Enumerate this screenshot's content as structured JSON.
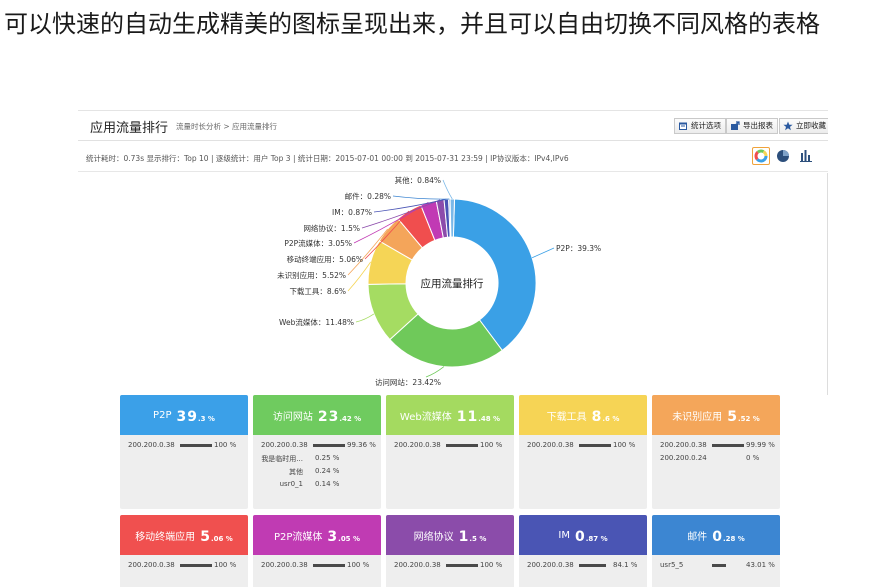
{
  "caption": "可以快速的自动生成精美的图标呈现出来，并且可以自由切换不同风格的表格",
  "header": {
    "title": "应用流量排行",
    "breadcrumb": "流量时长分析 > 应用流量排行",
    "buttons": [
      {
        "label": "统计选项",
        "icon": "calendar-icon"
      },
      {
        "label": "导出报表",
        "icon": "export-icon"
      },
      {
        "label": "立即收藏",
        "icon": "star-icon"
      }
    ]
  },
  "infobar": {
    "text": "统计耗时：0.73s   显示排行：Top 10   |   逐级统计：用户 Top 3   |   统计日期：2015-07-01 00:00 到 2015-07-31 23:59   |   IP协议版本：IPv4,IPv6",
    "view_buttons": [
      "donut-chart-icon",
      "pie-chart-icon",
      "bar-chart-icon"
    ]
  },
  "colors": {
    "p2p": "#3aa0e6",
    "visit": "#6fc95a",
    "web": "#a5dc62",
    "download": "#f5d556",
    "unknown": "#f4a55a",
    "mobile": "#f04e4e",
    "p2pmedia": "#c13ab4",
    "netproto": "#8c4cab",
    "im": "#4a54b5",
    "mail": "#3c85d1",
    "other": "#7ab8e8"
  },
  "chart_data": {
    "type": "pie",
    "title": "应用流量排行",
    "categories": [
      "P2P",
      "访问网站",
      "Web流媒体",
      "下载工具",
      "未识别应用",
      "移动终端应用",
      "P2P流媒体",
      "网络协议",
      "IM",
      "邮件",
      "其他"
    ],
    "values": [
      39.3,
      23.42,
      11.48,
      8.6,
      5.52,
      5.06,
      3.05,
      1.5,
      0.87,
      0.28,
      0.84
    ],
    "labels": [
      "P2P：39.3%",
      "访问网站：23.42%",
      "Web流媒体：11.48%",
      "下载工具：8.6%",
      "未识别应用：5.52%",
      "移动终端应用：5.06%",
      "P2P流媒体：3.05%",
      "网络协议：1.5%",
      "IM：0.87%",
      "邮件：0.28%",
      "其他：0.84%"
    ]
  },
  "cards": [
    {
      "label": "P2P",
      "big": "39",
      "small": ".3 %",
      "color": "#3ba0e8",
      "rows": [
        {
          "name": "200.200.0.38",
          "fill": 1.0,
          "pct": "100 %"
        }
      ]
    },
    {
      "label": "访问网站",
      "big": "23",
      "small": ".42 %",
      "color": "#6fcb5f",
      "rows": [
        {
          "name": "200.200.0.38",
          "fill": 0.9936,
          "pct": "99.36 %"
        },
        {
          "name": "我是临时用...",
          "pct": "0.25 %",
          "plain": true
        },
        {
          "name": "其他",
          "pct": "0.24 %",
          "plain": true
        },
        {
          "name": "usr0_1",
          "pct": "0.14 %",
          "plain": true
        }
      ]
    },
    {
      "label": "Web流媒体",
      "big": "11",
      "small": ".48 %",
      "color": "#a4da60",
      "rows": [
        {
          "name": "200.200.0.38",
          "fill": 1.0,
          "pct": "100 %"
        }
      ]
    },
    {
      "label": "下载工具",
      "big": "8",
      "small": ".6 %",
      "color": "#f6d455",
      "rows": [
        {
          "name": "200.200.0.38",
          "fill": 1.0,
          "pct": "100 %"
        }
      ]
    },
    {
      "label": "未识别应用",
      "big": "5",
      "small": ".52 %",
      "color": "#f4a65a",
      "rows": [
        {
          "name": "200.200.0.38",
          "fill": 0.9999,
          "pct": "99.99 %"
        },
        {
          "name": "200.200.0.24",
          "fill": 0.0,
          "pct": "0 %"
        }
      ]
    },
    {
      "label": "移动终端应用",
      "big": "5",
      "small": ".06 %",
      "color": "#f0504f",
      "rows": [
        {
          "name": "200.200.0.38",
          "fill": 1.0,
          "pct": "100 %"
        }
      ]
    },
    {
      "label": "P2P流媒体",
      "big": "3",
      "small": ".05 %",
      "color": "#c03bb3",
      "rows": [
        {
          "name": "200.200.0.38",
          "fill": 1.0,
          "pct": "100 %"
        }
      ]
    },
    {
      "label": "网络协议",
      "big": "1",
      "small": ".5 %",
      "color": "#8b4caa",
      "rows": [
        {
          "name": "200.200.0.38",
          "fill": 1.0,
          "pct": "100 %"
        }
      ]
    },
    {
      "label": "IM",
      "big": "0",
      "small": ".87 %",
      "color": "#4a55b4",
      "rows": [
        {
          "name": "200.200.0.38",
          "fill": 0.841,
          "pct": "84.1 %"
        }
      ]
    },
    {
      "label": "邮件",
      "big": "0",
      "small": ".28 %",
      "color": "#3c86d2",
      "rows": [
        {
          "name": "usr5_5",
          "fill": 0.4301,
          "pct": "43.01 %"
        }
      ]
    }
  ]
}
